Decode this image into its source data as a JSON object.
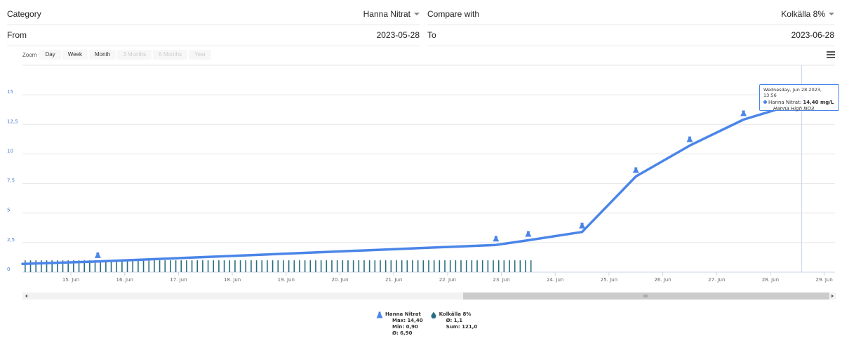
{
  "filters": {
    "category_label": "Category",
    "category_value": "Hanna Nitrat",
    "compare_label": "Compare with",
    "compare_value": "Kolkälla 8%",
    "from_label": "From",
    "from_value": "2023-05-28",
    "to_label": "To",
    "to_value": "2023-06-28"
  },
  "zoom": {
    "label": "Zoom",
    "buttons": [
      "Day",
      "Week",
      "Month",
      "3 Months",
      "6 Months",
      "Year"
    ],
    "enabled": [
      true,
      true,
      true,
      false,
      false,
      false
    ]
  },
  "tooltip": {
    "date": "Wednesday, Jun 28 2023, 13:56",
    "series": "Hanna Nitrat:",
    "value": "14,40 mg/L",
    "sub": "Hanna High NO3"
  },
  "legend": {
    "series1_name": "Hanna Nitrat",
    "series1_max": "Max: 14,40",
    "series1_min": "Min: 0,90",
    "series1_avg": "Ø: 6,90",
    "series2_name": "Kolkälla 8%",
    "series2_avg": "Ø: 1,1",
    "series2_sum": "Sum: 121,0"
  },
  "chart_data": {
    "type": "line",
    "x_tick_labels": [
      "15. Jun",
      "16. Jun",
      "17. Jun",
      "18. Jun",
      "19. Jun",
      "20. Jun",
      "21. Jun",
      "22. Jun",
      "23. Jun",
      "24. Jun",
      "25. Jun",
      "26. Jun",
      "27. Jun",
      "28. Jun",
      "29. Jun"
    ],
    "y_tick_labels": [
      "0",
      "2,5",
      "5",
      "7,5",
      "10",
      "12,5",
      "15"
    ],
    "ylim": [
      0,
      17.5
    ],
    "xlim_days": [
      14.1,
      29.2
    ],
    "grid": true,
    "series": [
      {
        "name": "Hanna Nitrat",
        "color": "#4a85e8",
        "points": [
          {
            "x_day": 14.1,
            "y": 0.7
          },
          {
            "x_day": 15.5,
            "y": 0.9
          },
          {
            "x_day": 22.9,
            "y": 2.3
          },
          {
            "x_day": 23.5,
            "y": 2.7
          },
          {
            "x_day": 24.5,
            "y": 3.4
          },
          {
            "x_day": 25.5,
            "y": 8.1
          },
          {
            "x_day": 26.5,
            "y": 10.7
          },
          {
            "x_day": 27.5,
            "y": 12.9
          },
          {
            "x_day": 28.58,
            "y": 14.4
          }
        ],
        "markers_x_day": [
          15.5,
          22.9,
          23.5,
          24.5,
          25.5,
          26.5,
          27.5,
          28.58
        ]
      },
      {
        "name": "Kolkälla 8%",
        "color": "#2a6d7e",
        "type": "column",
        "x_start_day": 14.15,
        "x_end_day": 23.55,
        "step_day": 0.1,
        "value": 1.0
      }
    ],
    "highlight_x_day": 28.58
  }
}
